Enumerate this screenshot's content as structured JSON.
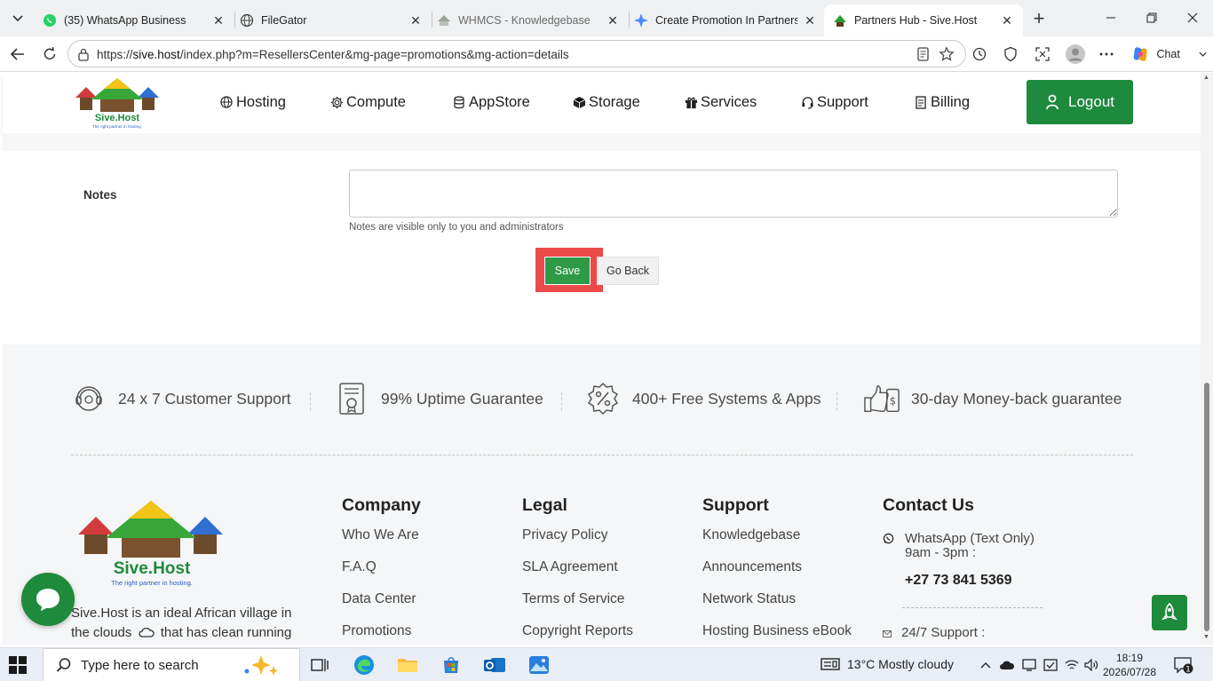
{
  "browser": {
    "tabs": [
      {
        "label": "(35) WhatsApp Business",
        "active": false
      },
      {
        "label": "FileGator",
        "active": false
      },
      {
        "label": "WHMCS - Knowledgebase",
        "active": false
      },
      {
        "label": "Create Promotion In Partners H",
        "active": false
      },
      {
        "label": "Partners Hub - Sive.Host",
        "active": true
      }
    ],
    "url_prefix": "https://",
    "url_host": "sive.host",
    "url_path": "/index.php?m=ResellersCenter&mg-page=promotions&mg-action=details",
    "chat_label": "Chat"
  },
  "site": {
    "logo_text": "Sive.Host",
    "logo_tagline": "The right partner in hosting.",
    "nav": [
      "Hosting",
      "Compute",
      "AppStore",
      "Storage",
      "Services",
      "Support",
      "Billing"
    ],
    "logout_label": "Logout",
    "accent": "#1e8a3c"
  },
  "form": {
    "notes_label": "Notes",
    "notes_value": "",
    "notes_help": "Notes are visible only to you and administrators",
    "save_label": "Save",
    "goback_label": "Go Back"
  },
  "footer": {
    "features": [
      "24 x 7 Customer Support",
      "99% Uptime Guarantee",
      "400+ Free Systems & Apps",
      "30-day Money-back guarantee"
    ],
    "description_pre": "Sive.Host is an ideal African village in the clouds",
    "description_post": "that has clean running",
    "columns": [
      {
        "title": "Company",
        "links": [
          "Who We Are",
          "F.A.Q",
          "Data Center",
          "Promotions"
        ]
      },
      {
        "title": "Legal",
        "links": [
          "Privacy Policy",
          "SLA Agreement",
          "Terms of Service",
          "Copyright Reports"
        ]
      },
      {
        "title": "Support",
        "links": [
          "Knowledgebase",
          "Announcements",
          "Network Status",
          "Hosting Business eBook"
        ]
      }
    ],
    "contact": {
      "title": "Contact Us",
      "whatsapp_label": "WhatsApp (Text Only)",
      "whatsapp_hours": "9am - 3pm :",
      "phone": "+27 73 841 5369",
      "support_label": "24/7 Support :"
    }
  },
  "taskbar": {
    "search_placeholder": "Type here to search",
    "weather": "13°C  Mostly cloudy",
    "time": "18:19",
    "date": "2026/07/28",
    "notification_count": "1"
  }
}
